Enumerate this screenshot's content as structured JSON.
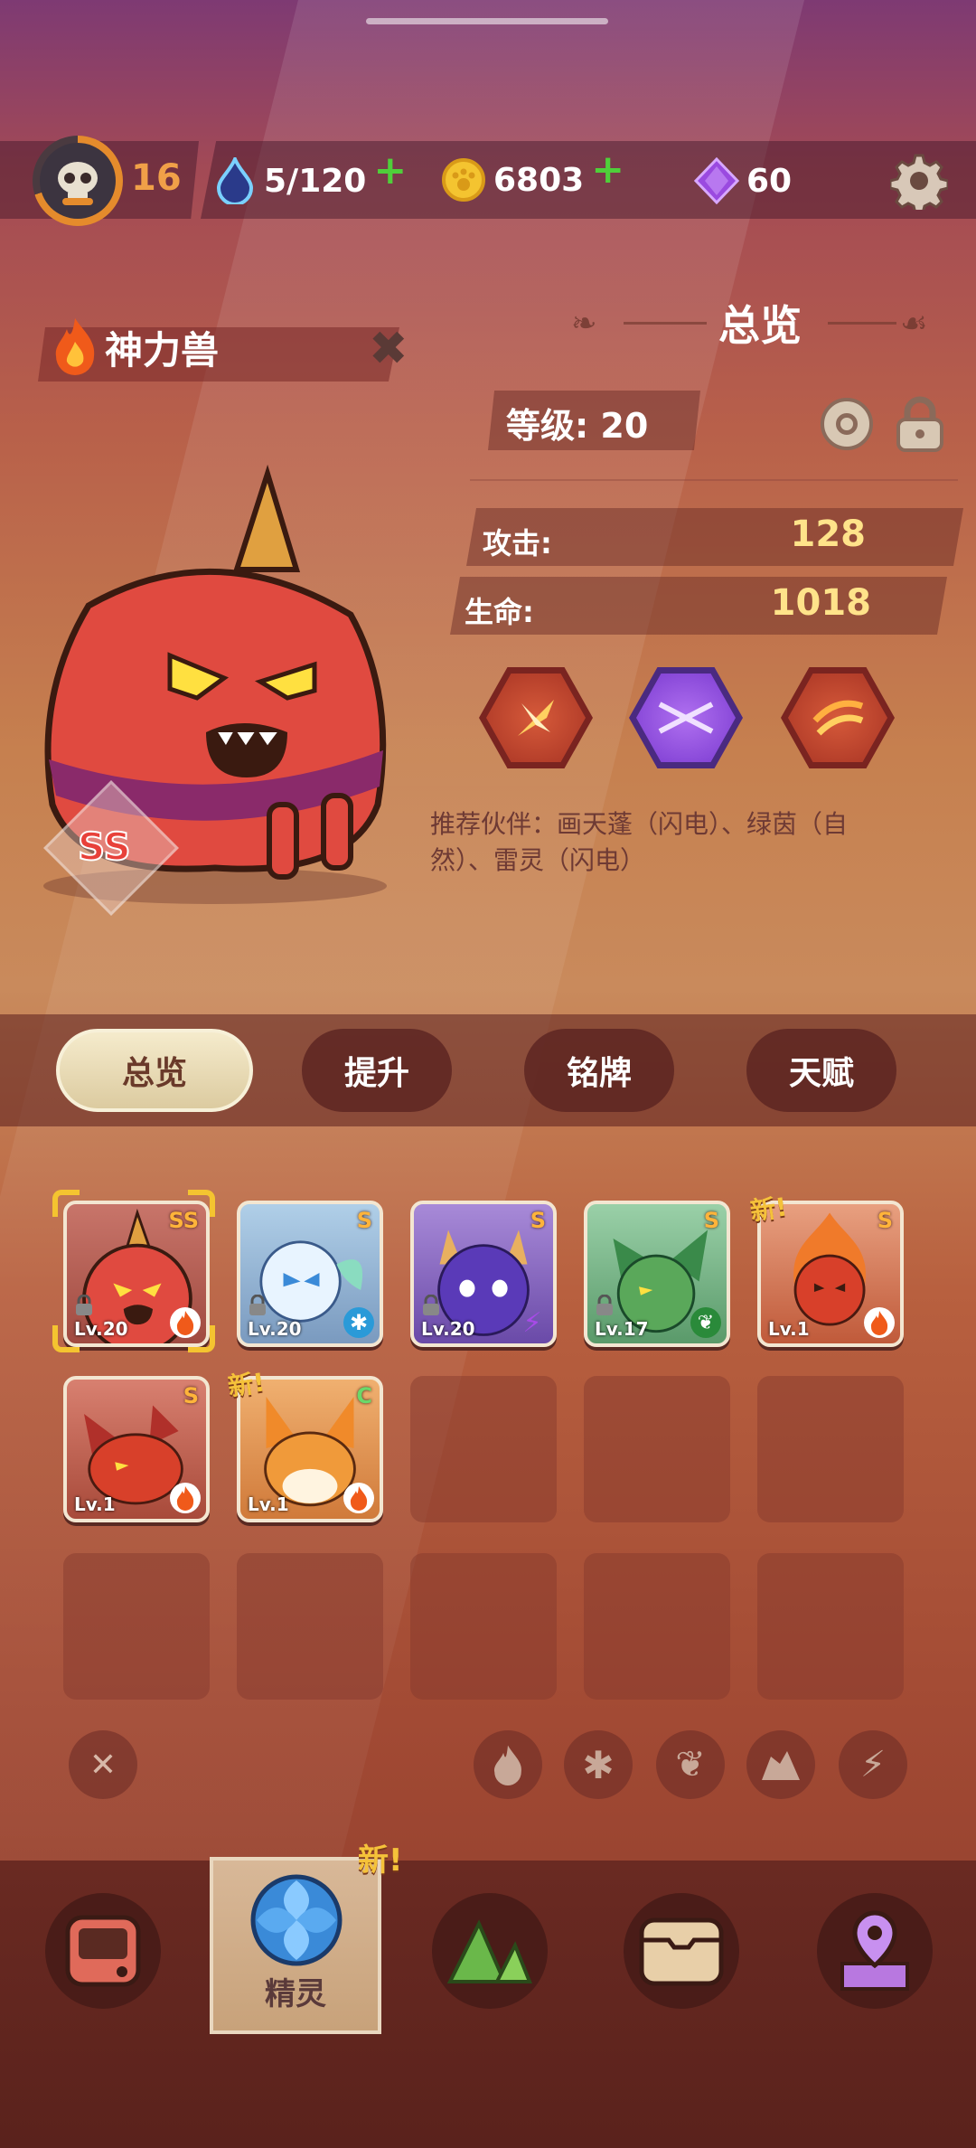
{
  "status": {
    "player_level": "16",
    "stamina": "5/120",
    "coins": "6803",
    "gems": "60"
  },
  "spirit": {
    "name": "神力兽",
    "rank": "SS"
  },
  "overview": {
    "title": "总览",
    "level_label": "等级: 20",
    "attack_label": "攻击:",
    "attack_value": "128",
    "hp_label": "生命:",
    "hp_value": "1018",
    "recommend_line1": "推荐伙伴：画天蓬（闪电）、绿茵（自",
    "recommend_line2": "然）、雷灵（闪电）"
  },
  "tabs": [
    {
      "label": "总览"
    },
    {
      "label": "提升"
    },
    {
      "label": "铭牌"
    },
    {
      "label": "天赋"
    }
  ],
  "roster": [
    {
      "rank": "SS",
      "level": "Lv.20",
      "element": "fire",
      "locked": true,
      "new": false,
      "selected": true
    },
    {
      "rank": "S",
      "level": "Lv.20",
      "element": "ice",
      "locked": true,
      "new": false
    },
    {
      "rank": "S",
      "level": "Lv.20",
      "element": "lightning",
      "locked": true,
      "new": false
    },
    {
      "rank": "S",
      "level": "Lv.17",
      "element": "nature",
      "locked": true,
      "new": false
    },
    {
      "rank": "S",
      "level": "Lv.1",
      "element": "fire",
      "locked": false,
      "new": true,
      "new_label": "新!"
    },
    {
      "rank": "S",
      "level": "Lv.1",
      "element": "fire",
      "locked": false,
      "new": false
    },
    {
      "rank": "C",
      "level": "Lv.1",
      "element": "fire",
      "locked": false,
      "new": true,
      "new_label": "新!"
    }
  ],
  "filters": [
    "close-icon",
    "fire-icon",
    "ice-icon",
    "leaf-icon",
    "earth-icon",
    "lightning-icon"
  ],
  "bottom_nav": {
    "active_label": "精灵",
    "new_badge": "新!"
  },
  "colors": {
    "accent_gold": "#ffe38a",
    "level_orange": "#f0a048",
    "plus_green": "#4fcf3a"
  }
}
